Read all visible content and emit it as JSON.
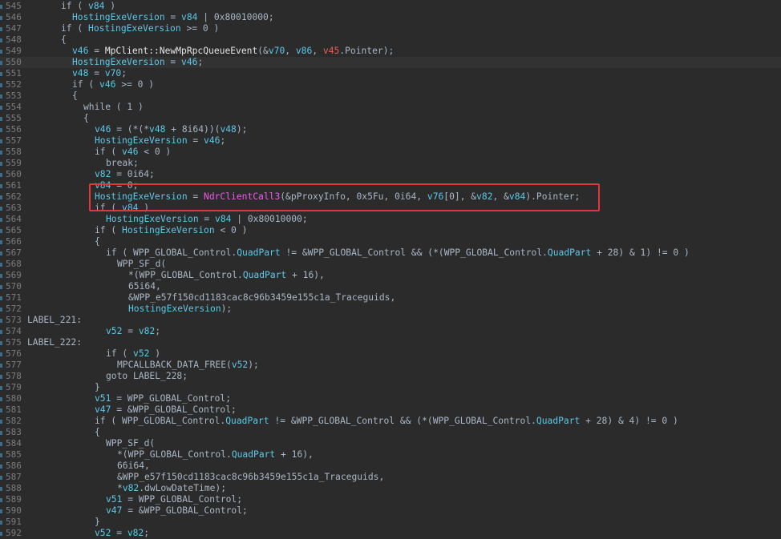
{
  "editor": {
    "lines": [
      {
        "num": "545",
        "indent": 3,
        "tokens": [
          [
            "plain",
            "if ( "
          ],
          [
            "var",
            "v84"
          ],
          [
            "plain",
            " )"
          ]
        ]
      },
      {
        "num": "546",
        "indent": 4,
        "tokens": [
          [
            "var",
            "HostingExeVersion"
          ],
          [
            "plain",
            " = "
          ],
          [
            "var",
            "v84"
          ],
          [
            "plain",
            " | 0x80010000;"
          ]
        ]
      },
      {
        "num": "547",
        "indent": 3,
        "tokens": [
          [
            "plain",
            "if ( "
          ],
          [
            "var",
            "HostingExeVersion"
          ],
          [
            "plain",
            " >= 0 )"
          ]
        ]
      },
      {
        "num": "548",
        "indent": 3,
        "tokens": [
          [
            "plain",
            "{"
          ]
        ]
      },
      {
        "num": "549",
        "indent": 4,
        "tokens": [
          [
            "var",
            "v46"
          ],
          [
            "plain",
            " = "
          ],
          [
            "func",
            "MpClient::NewMpRpcQueueEvent"
          ],
          [
            "plain",
            "(&"
          ],
          [
            "var",
            "v70"
          ],
          [
            "plain",
            ", "
          ],
          [
            "var",
            "v86"
          ],
          [
            "plain",
            ", "
          ],
          [
            "hlvar",
            "v45"
          ],
          [
            "plain",
            ".Pointer);"
          ]
        ]
      },
      {
        "num": "550",
        "indent": 4,
        "highlight": true,
        "tokens": [
          [
            "var",
            "HostingExeVersion"
          ],
          [
            "plain",
            " = "
          ],
          [
            "var",
            "v46"
          ],
          [
            "plain",
            ";"
          ]
        ]
      },
      {
        "num": "551",
        "indent": 4,
        "tokens": [
          [
            "var",
            "v48"
          ],
          [
            "plain",
            " = "
          ],
          [
            "var",
            "v70"
          ],
          [
            "plain",
            ";"
          ]
        ]
      },
      {
        "num": "552",
        "indent": 4,
        "tokens": [
          [
            "plain",
            "if ( "
          ],
          [
            "var",
            "v46"
          ],
          [
            "plain",
            " >= 0 )"
          ]
        ]
      },
      {
        "num": "553",
        "indent": 4,
        "tokens": [
          [
            "plain",
            "{"
          ]
        ]
      },
      {
        "num": "554",
        "indent": 5,
        "tokens": [
          [
            "plain",
            "while ( 1 )"
          ]
        ]
      },
      {
        "num": "555",
        "indent": 5,
        "tokens": [
          [
            "plain",
            "{"
          ]
        ]
      },
      {
        "num": "556",
        "indent": 6,
        "tokens": [
          [
            "var",
            "v46"
          ],
          [
            "plain",
            " = (*(*"
          ],
          [
            "var",
            "v48"
          ],
          [
            "plain",
            " + 8i64))("
          ],
          [
            "var",
            "v48"
          ],
          [
            "plain",
            ");"
          ]
        ]
      },
      {
        "num": "557",
        "indent": 6,
        "tokens": [
          [
            "var",
            "HostingExeVersion"
          ],
          [
            "plain",
            " = "
          ],
          [
            "var",
            "v46"
          ],
          [
            "plain",
            ";"
          ]
        ]
      },
      {
        "num": "558",
        "indent": 6,
        "tokens": [
          [
            "plain",
            "if ( "
          ],
          [
            "var",
            "v46"
          ],
          [
            "plain",
            " < 0 )"
          ]
        ]
      },
      {
        "num": "559",
        "indent": 7,
        "tokens": [
          [
            "plain",
            "break;"
          ]
        ]
      },
      {
        "num": "560",
        "indent": 6,
        "tokens": [
          [
            "var",
            "v82"
          ],
          [
            "plain",
            " = 0i64;"
          ]
        ]
      },
      {
        "num": "561",
        "indent": 6,
        "tokens": [
          [
            "var",
            "v84"
          ],
          [
            "plain",
            " = 0;"
          ]
        ]
      },
      {
        "num": "562",
        "indent": 6,
        "tokens": [
          [
            "var",
            "HostingExeVersion"
          ],
          [
            "plain",
            " = "
          ],
          [
            "call",
            "NdrClientCall3"
          ],
          [
            "plain",
            "(&pProxyInfo, 0x5Fu, 0i64, "
          ],
          [
            "var",
            "v76"
          ],
          [
            "plain",
            "[0], &"
          ],
          [
            "var",
            "v82"
          ],
          [
            "plain",
            ", &"
          ],
          [
            "var",
            "v84"
          ],
          [
            "plain",
            ").Pointer;"
          ]
        ]
      },
      {
        "num": "563",
        "indent": 6,
        "tokens": [
          [
            "plain",
            "if ( "
          ],
          [
            "var",
            "v84"
          ],
          [
            "plain",
            " )"
          ]
        ]
      },
      {
        "num": "564",
        "indent": 7,
        "tokens": [
          [
            "var",
            "HostingExeVersion"
          ],
          [
            "plain",
            " = "
          ],
          [
            "var",
            "v84"
          ],
          [
            "plain",
            " | 0x80010000;"
          ]
        ]
      },
      {
        "num": "565",
        "indent": 6,
        "tokens": [
          [
            "plain",
            "if ( "
          ],
          [
            "var",
            "HostingExeVersion"
          ],
          [
            "plain",
            " < 0 )"
          ]
        ]
      },
      {
        "num": "566",
        "indent": 6,
        "tokens": [
          [
            "plain",
            "{"
          ]
        ]
      },
      {
        "num": "567",
        "indent": 7,
        "tokens": [
          [
            "plain",
            "if ( WPP_GLOBAL_Control."
          ],
          [
            "var",
            "QuadPart"
          ],
          [
            "plain",
            " != &WPP_GLOBAL_Control && (*(WPP_GLOBAL_Control."
          ],
          [
            "var",
            "QuadPart"
          ],
          [
            "plain",
            " + 28) & 1) != 0 )"
          ]
        ]
      },
      {
        "num": "568",
        "indent": 8,
        "tokens": [
          [
            "plain",
            "WPP_SF_d("
          ]
        ]
      },
      {
        "num": "569",
        "indent": 9,
        "tokens": [
          [
            "plain",
            "*(WPP_GLOBAL_Control."
          ],
          [
            "var",
            "QuadPart"
          ],
          [
            "plain",
            " + 16),"
          ]
        ]
      },
      {
        "num": "570",
        "indent": 9,
        "tokens": [
          [
            "plain",
            "65i64,"
          ]
        ]
      },
      {
        "num": "571",
        "indent": 9,
        "tokens": [
          [
            "plain",
            "&WPP_e57f150cd1183cac8c96b3459e155c1a_Traceguids,"
          ]
        ]
      },
      {
        "num": "572",
        "indent": 9,
        "tokens": [
          [
            "var",
            "HostingExeVersion"
          ],
          [
            "plain",
            ");"
          ]
        ]
      },
      {
        "num": "573",
        "indent": 0,
        "tokens": [
          [
            "label",
            "LABEL_221:"
          ]
        ]
      },
      {
        "num": "574",
        "indent": 7,
        "tokens": [
          [
            "var",
            "v52"
          ],
          [
            "plain",
            " = "
          ],
          [
            "var",
            "v82"
          ],
          [
            "plain",
            ";"
          ]
        ]
      },
      {
        "num": "575",
        "indent": 0,
        "tokens": [
          [
            "label",
            "LABEL_222:"
          ]
        ]
      },
      {
        "num": "576",
        "indent": 7,
        "tokens": [
          [
            "plain",
            "if ( "
          ],
          [
            "var",
            "v52"
          ],
          [
            "plain",
            " )"
          ]
        ]
      },
      {
        "num": "577",
        "indent": 8,
        "tokens": [
          [
            "plain",
            "MPCALLBACK_DATA_FREE("
          ],
          [
            "var",
            "v52"
          ],
          [
            "plain",
            ");"
          ]
        ]
      },
      {
        "num": "578",
        "indent": 7,
        "tokens": [
          [
            "plain",
            "goto LABEL_228;"
          ]
        ]
      },
      {
        "num": "579",
        "indent": 6,
        "tokens": [
          [
            "plain",
            "}"
          ]
        ]
      },
      {
        "num": "580",
        "indent": 6,
        "tokens": [
          [
            "var",
            "v51"
          ],
          [
            "plain",
            " = WPP_GLOBAL_Control;"
          ]
        ]
      },
      {
        "num": "581",
        "indent": 6,
        "tokens": [
          [
            "var",
            "v47"
          ],
          [
            "plain",
            " = &WPP_GLOBAL_Control;"
          ]
        ]
      },
      {
        "num": "582",
        "indent": 6,
        "tokens": [
          [
            "plain",
            "if ( WPP_GLOBAL_Control."
          ],
          [
            "var",
            "QuadPart"
          ],
          [
            "plain",
            " != &WPP_GLOBAL_Control && (*(WPP_GLOBAL_Control."
          ],
          [
            "var",
            "QuadPart"
          ],
          [
            "plain",
            " + 28) & 4) != 0 )"
          ]
        ]
      },
      {
        "num": "583",
        "indent": 6,
        "tokens": [
          [
            "plain",
            "{"
          ]
        ]
      },
      {
        "num": "584",
        "indent": 7,
        "tokens": [
          [
            "plain",
            "WPP_SF_d("
          ]
        ]
      },
      {
        "num": "585",
        "indent": 8,
        "tokens": [
          [
            "plain",
            "*(WPP_GLOBAL_Control."
          ],
          [
            "var",
            "QuadPart"
          ],
          [
            "plain",
            " + 16),"
          ]
        ]
      },
      {
        "num": "586",
        "indent": 8,
        "tokens": [
          [
            "plain",
            "66i64,"
          ]
        ]
      },
      {
        "num": "587",
        "indent": 8,
        "tokens": [
          [
            "plain",
            "&WPP_e57f150cd1183cac8c96b3459e155c1a_Traceguids,"
          ]
        ]
      },
      {
        "num": "588",
        "indent": 8,
        "tokens": [
          [
            "plain",
            "*"
          ],
          [
            "var",
            "v82"
          ],
          [
            "plain",
            ".dwLowDateTime);"
          ]
        ]
      },
      {
        "num": "589",
        "indent": 7,
        "tokens": [
          [
            "var",
            "v51"
          ],
          [
            "plain",
            " = WPP_GLOBAL_Control;"
          ]
        ]
      },
      {
        "num": "590",
        "indent": 7,
        "tokens": [
          [
            "var",
            "v47"
          ],
          [
            "plain",
            " = &WPP_GLOBAL_Control;"
          ]
        ]
      },
      {
        "num": "591",
        "indent": 6,
        "tokens": [
          [
            "plain",
            "}"
          ]
        ]
      },
      {
        "num": "592",
        "indent": 6,
        "tokens": [
          [
            "var",
            "v52"
          ],
          [
            "plain",
            " = "
          ],
          [
            "var",
            "v82"
          ],
          [
            "plain",
            ";"
          ]
        ]
      }
    ]
  },
  "colors": {
    "background": "#2b2b2b",
    "variable": "#5ec8e8",
    "call": "#ee5be9",
    "highlight_box": "#e0373b"
  }
}
